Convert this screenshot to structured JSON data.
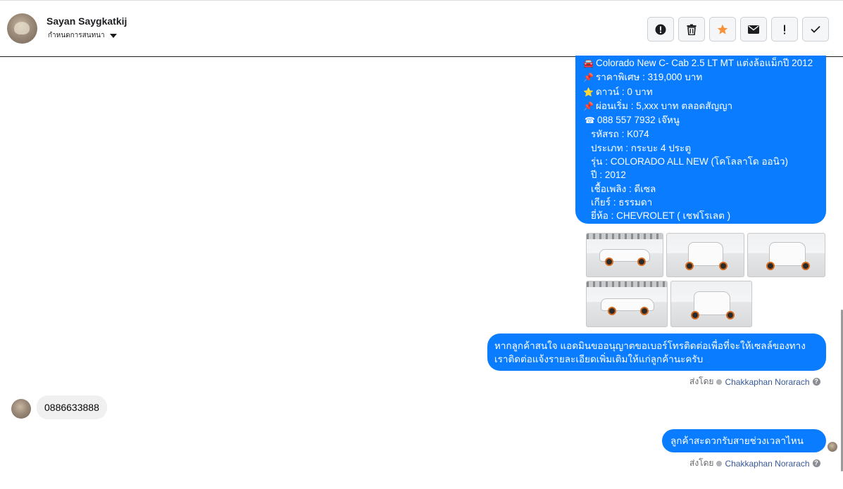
{
  "header": {
    "contact_name": "Sayan Saygkatkij",
    "contact_sub": "กำหนดการสนทนา",
    "actions": [
      {
        "icon": "alert-circle-icon",
        "name": "mark-spam-button"
      },
      {
        "icon": "trash-icon",
        "name": "delete-button"
      },
      {
        "icon": "star-icon",
        "name": "star-button"
      },
      {
        "icon": "envelope-icon",
        "name": "mark-unread-button"
      },
      {
        "icon": "exclamation-icon",
        "name": "important-button"
      },
      {
        "icon": "check-icon",
        "name": "done-button"
      }
    ]
  },
  "listing": {
    "lines": [
      {
        "icon": "🚘",
        "text": "Colorado New C- Cab 2.5 LT MT แต่งล้อแม็กปี 2012"
      },
      {
        "icon": "📌",
        "text": "ราคาพิเศษ : 319,000 บาท"
      },
      {
        "icon": "⭐",
        "text": "ดาวน์ : 0 บาท"
      },
      {
        "icon": "📌",
        "text": "ผ่อนเริ่ม : 5,xxx บาท ตลอดสัญญา"
      },
      {
        "icon": "☎",
        "text": "088 557 7932 เจ๊หนู"
      },
      {
        "icon": "",
        "text": "รหัสรถ : K074"
      },
      {
        "icon": "",
        "text": "ประเภท : กระบะ 4 ประตู"
      },
      {
        "icon": "",
        "text": "รุ่น : COLORADO ALL NEW (โคโลลาโด ออนิว)"
      },
      {
        "icon": "",
        "text": "ปี : 2012"
      },
      {
        "icon": "",
        "text": "เชื้อเพลิง : ดีเซล"
      },
      {
        "icon": "",
        "text": "เกียร์ : ธรรมดา"
      },
      {
        "icon": "",
        "text": "ยี่ห้อ : CHEVROLET ( เชฟโรเลต )"
      }
    ]
  },
  "message_admin": "หากลูกค้าสนใจ แอดมินขออนุญาตขอเบอร์โทรติดต่อเพื่อที่จะให้เซลล์ของทางเราติดต่อแจ้งรายละเอียดเพิ่มเติมให้แก่ลูกค้านะครับ",
  "sent_by_prefix": "ส่งโดย",
  "agent_name": "Chakkaphan Norarach",
  "help_mark": "?",
  "message_customer": "0886633888",
  "message_question": "ลูกค้าสะดวกรับสายช่วงเวลาไหนครับ",
  "colors": {
    "outgoing": "#0a7cff",
    "incoming": "#f0f0f0",
    "star": "#f7923a"
  }
}
